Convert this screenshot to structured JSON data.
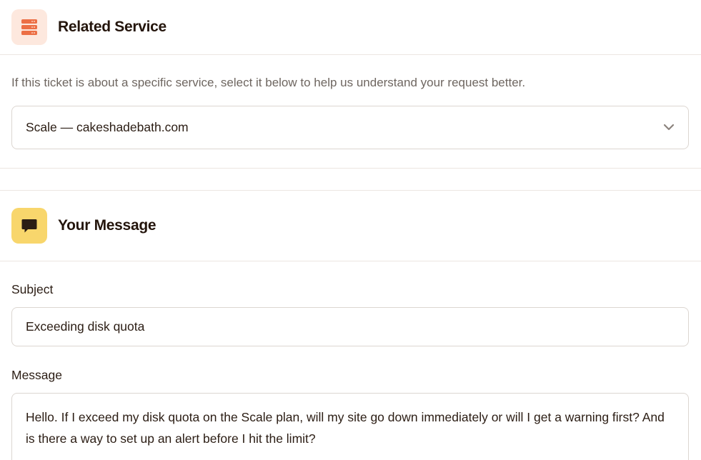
{
  "related_service": {
    "title": "Related Service",
    "icon": "server-stack-icon",
    "helper": "If this ticket is about a specific service, select it below to help us understand your request better.",
    "selected": "Scale — cakeshadebath.com"
  },
  "your_message": {
    "title": "Your Message",
    "icon": "chat-bubble-icon",
    "subject_label": "Subject",
    "subject_value": "Exceeding disk quota",
    "message_label": "Message",
    "message_value": "Hello. If I exceed my disk quota on the Scale plan, will my site go down immediately or will I get a warning first? And is there a way to set up an alert before I hit the limit?"
  },
  "colors": {
    "peach_icon_bg": "#fde8de",
    "peach_icon_fg": "#ec6f45",
    "yellow_icon_bg": "#f8d66c",
    "yellow_icon_fg": "#2b1d14",
    "border": "#dcd6d1"
  }
}
